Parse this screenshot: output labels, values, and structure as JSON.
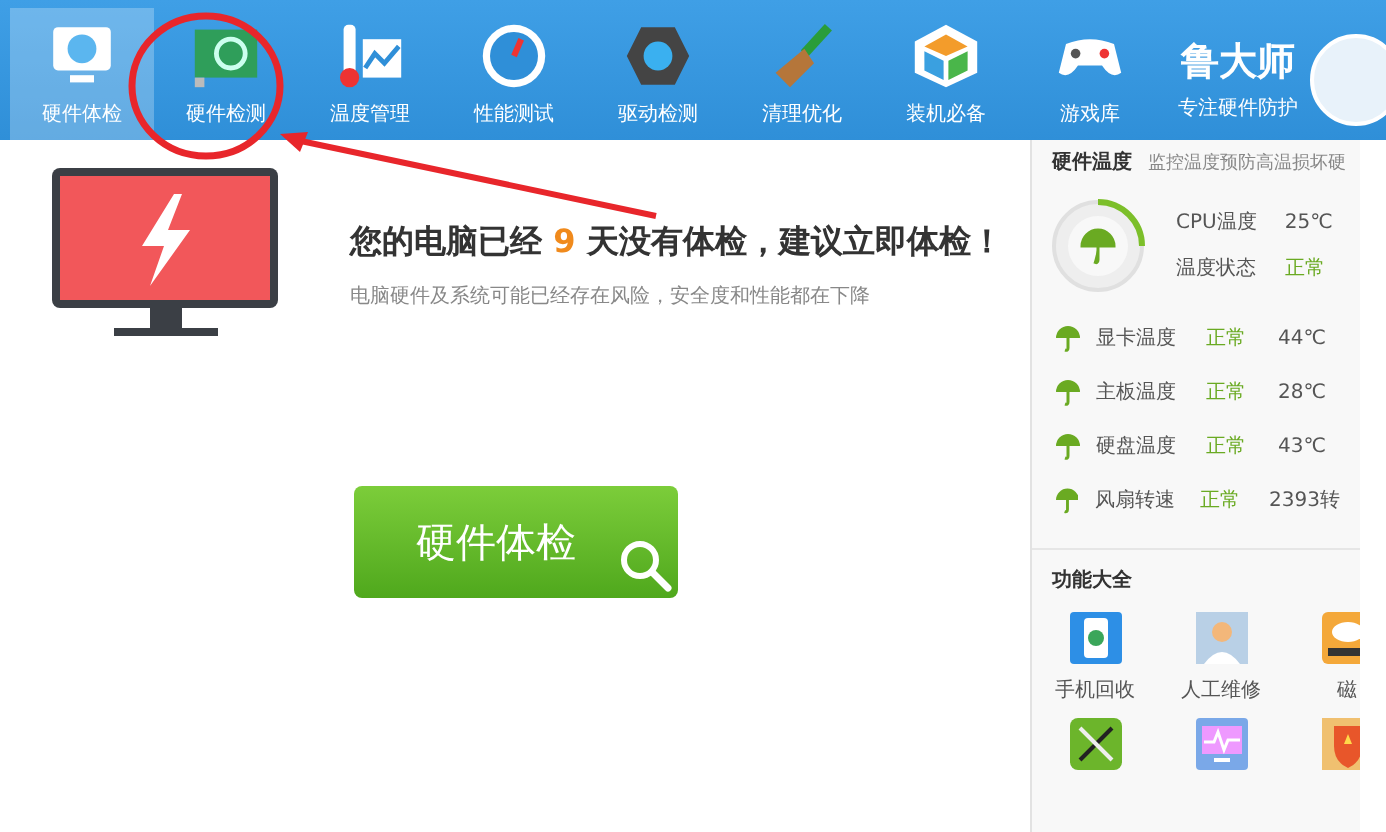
{
  "tabs": [
    {
      "label": "硬件体检",
      "selected": true
    },
    {
      "label": "硬件检测",
      "selected": false
    },
    {
      "label": "温度管理",
      "selected": false
    },
    {
      "label": "性能测试",
      "selected": false
    },
    {
      "label": "驱动检测",
      "selected": false
    },
    {
      "label": "清理优化",
      "selected": false
    },
    {
      "label": "装机必备",
      "selected": false
    },
    {
      "label": "游戏库",
      "selected": false
    }
  ],
  "brand": {
    "name": "鲁大师",
    "slogan": "专注硬件防护"
  },
  "main": {
    "headline": "您的电脑已经 **9** 天没有体检，建议立即体检！",
    "subtext": "电脑硬件及系统可能已经存在风险，安全度和性能都在下降",
    "button": "硬件体检"
  },
  "temperature": {
    "title": "硬件温度",
    "description": "监控温度预防高温损坏硬",
    "cpu_label": "CPU温度",
    "cpu_value": "25℃",
    "status_label": "温度状态",
    "status_value": "正常",
    "rows": [
      {
        "name": "显卡温度",
        "status": "正常",
        "value": "44℃"
      },
      {
        "name": "主板温度",
        "status": "正常",
        "value": "28℃"
      },
      {
        "name": "硬盘温度",
        "status": "正常",
        "value": "43℃"
      },
      {
        "name": "风扇转速",
        "status": "正常",
        "value": "2393转"
      }
    ]
  },
  "features": {
    "title": "功能大全",
    "items": [
      {
        "kind": "phone",
        "label": "手机回收"
      },
      {
        "kind": "doctor",
        "label": "人工维修"
      },
      {
        "kind": "disk",
        "label": "磁"
      },
      {
        "kind": "tools"
      },
      {
        "kind": "monitor"
      },
      {
        "kind": "shield"
      }
    ]
  }
}
